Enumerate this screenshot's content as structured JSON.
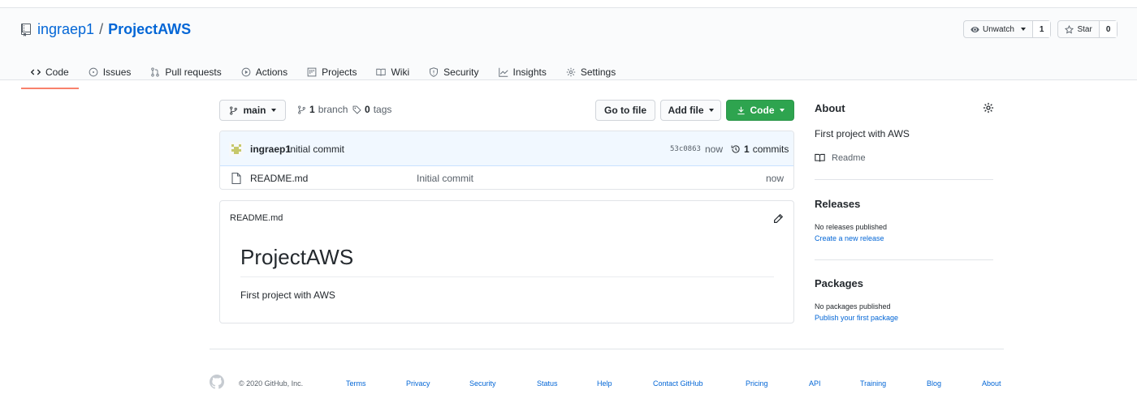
{
  "repo": {
    "owner": "ingraep1",
    "separator": "/",
    "name": "ProjectAWS"
  },
  "header_actions": {
    "watch_label": "Unwatch",
    "watch_count": "1",
    "star_label": "Star",
    "star_count": "0"
  },
  "tabs": [
    {
      "label": "Code",
      "icon": "code-icon"
    },
    {
      "label": "Issues",
      "icon": "issue-icon"
    },
    {
      "label": "Pull requests",
      "icon": "pull-request-icon"
    },
    {
      "label": "Actions",
      "icon": "play-icon"
    },
    {
      "label": "Projects",
      "icon": "project-icon"
    },
    {
      "label": "Wiki",
      "icon": "book-icon"
    },
    {
      "label": "Security",
      "icon": "shield-icon"
    },
    {
      "label": "Insights",
      "icon": "graph-icon"
    },
    {
      "label": "Settings",
      "icon": "gear-icon"
    }
  ],
  "toolbar": {
    "branch": "main",
    "branch_count": "1",
    "branch_word": "branch",
    "tag_count": "0",
    "tag_word": "tags",
    "go_to_file": "Go to file",
    "add_file": "Add file",
    "code": "Code"
  },
  "commit": {
    "author": "ingraep1",
    "message": "Initial commit",
    "sha": "53c0863",
    "time": "now",
    "count": "1",
    "count_word": "commits"
  },
  "files": [
    {
      "name": "README.md",
      "message": "Initial commit",
      "age": "now"
    }
  ],
  "readme": {
    "filename": "README.md",
    "heading": "ProjectAWS",
    "body": "First project with AWS"
  },
  "about": {
    "heading": "About",
    "description": "First project with AWS",
    "readme_link": "Readme"
  },
  "releases": {
    "heading": "Releases",
    "empty": "No releases published",
    "link": "Create a new release"
  },
  "packages": {
    "heading": "Packages",
    "empty": "No packages published",
    "link": "Publish your first package"
  },
  "footer": {
    "copyright": "© 2020 GitHub, Inc.",
    "links": [
      "Terms",
      "Privacy",
      "Security",
      "Status",
      "Help",
      "Contact GitHub",
      "Pricing",
      "API",
      "Training",
      "Blog",
      "About"
    ]
  },
  "colors": {
    "accent_link": "#0366d6",
    "green_button": "#2ea44f",
    "active_tab_underline": "#f9826c",
    "commit_bg": "#f1f8ff"
  }
}
